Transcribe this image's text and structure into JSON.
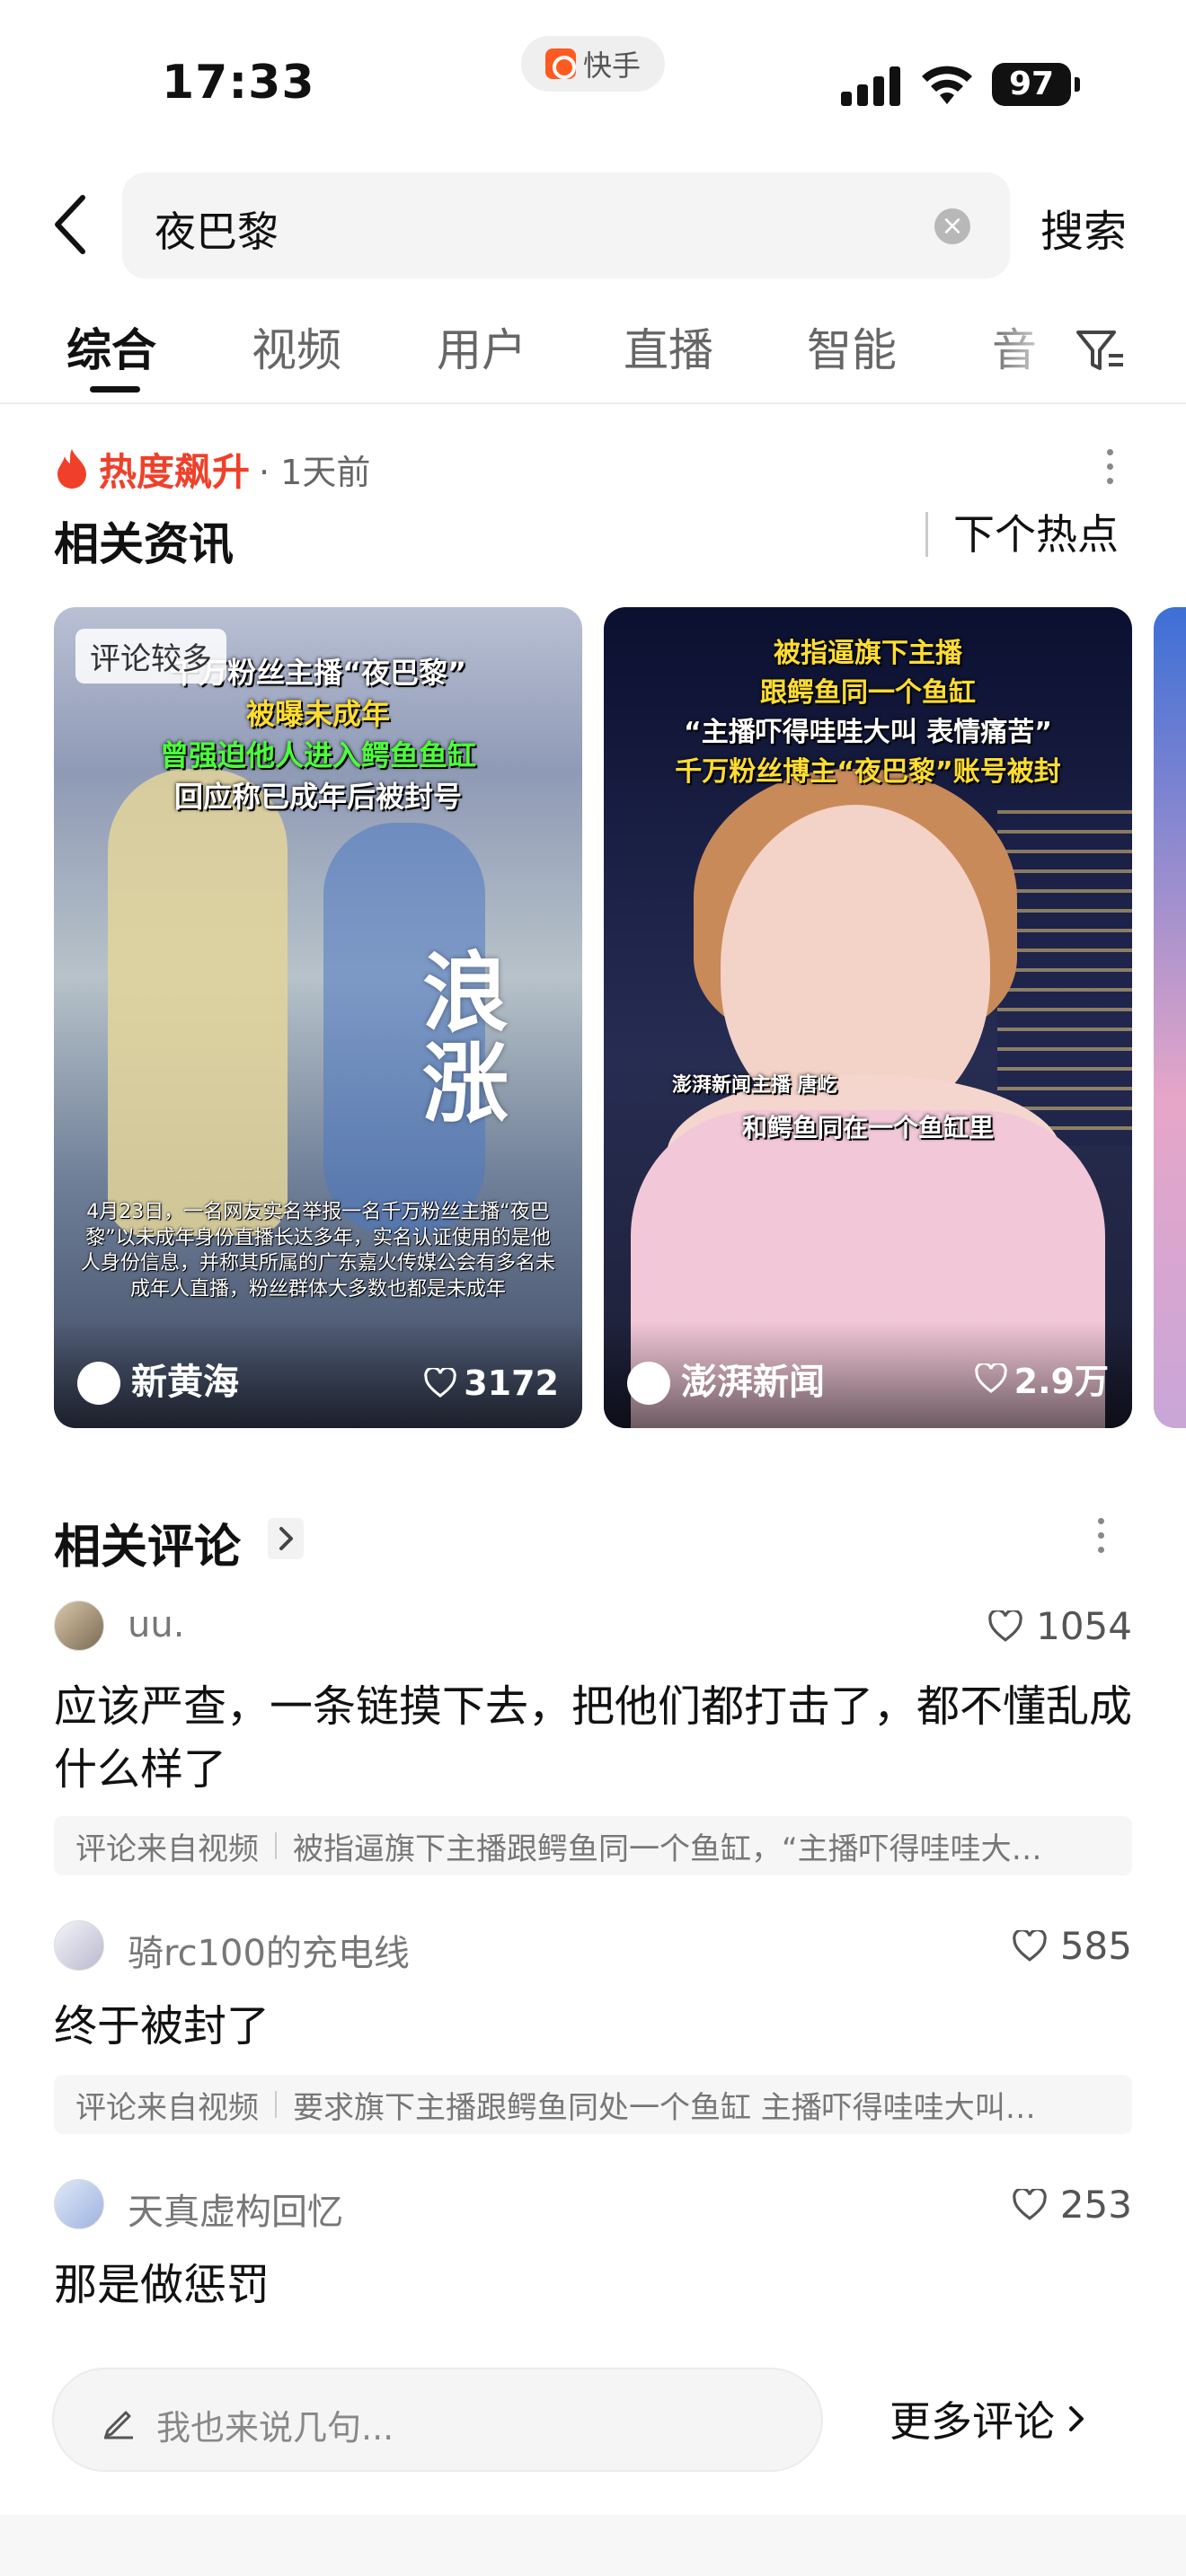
{
  "status_bar": {
    "time": "17:33",
    "app_name": "快手",
    "battery": "97"
  },
  "search": {
    "query": "夜巴黎",
    "button_label": "搜索"
  },
  "tabs": [
    {
      "label": "综合",
      "active": true
    },
    {
      "label": "视频"
    },
    {
      "label": "用户"
    },
    {
      "label": "直播"
    },
    {
      "label": "智能"
    },
    {
      "label": "音"
    }
  ],
  "news": {
    "hot_label": "热度飙升",
    "hot_time": "· 1天前",
    "section_title": "相关资讯",
    "next_hot": "下个热点",
    "cards": [
      {
        "badge": "评论较多",
        "caption": [
          "千万粉丝主播“夜巴黎”",
          "被曝未成年",
          "曾强迫他人进入鳄鱼鱼缸",
          "回应称已成年后被封号"
        ],
        "overlay_title": "浪涨",
        "body": "4月23日，一名网友实名举报一名千万粉丝主播“夜巴黎”以未成年身份直播长达多年，实名认证使用的是他人身份信息，并称其所属的广东嘉火传媒公会有多名未成年人直播，粉丝群体大多数也都是未成年",
        "source": "新黄海",
        "likes": "3172"
      },
      {
        "caption": [
          "被指逼旗下主播",
          "跟鳄鱼同一个鱼缸",
          "“主播吓得哇哇大叫 表情痛苦”",
          "千万粉丝博主“夜巴黎”账号被封"
        ],
        "sub1": "澎湃新闻主播 唐屹",
        "sub2": "和鳄鱼同在一个鱼缸里",
        "source": "澎湃新闻",
        "likes": "2.9万"
      }
    ]
  },
  "comments": {
    "section_title": "相关评论",
    "items": [
      {
        "user": "uu.",
        "likes": "1054",
        "text": "应该严查，一条链摸下去，把他们都打击了，都不懂乱成什么样了",
        "source_label": "评论来自视频",
        "source_text": "被指逼旗下主播跟鳄鱼同一个鱼缸，“主播吓得哇哇大…"
      },
      {
        "user": "骑rc100的充电线",
        "likes": "585",
        "text": "终于被封了",
        "source_label": "评论来自视频",
        "source_text": "要求旗下主播跟鳄鱼同处一个鱼缸 主播吓得哇哇大叫…"
      },
      {
        "user": "天真虚构回忆",
        "likes": "253",
        "text": "那是做惩罚"
      }
    ]
  },
  "bottom": {
    "input_placeholder": "我也来说几句...",
    "more_comments": "更多评论"
  },
  "colors": {
    "hot": "#f0402a",
    "accent_text": "#111111"
  }
}
